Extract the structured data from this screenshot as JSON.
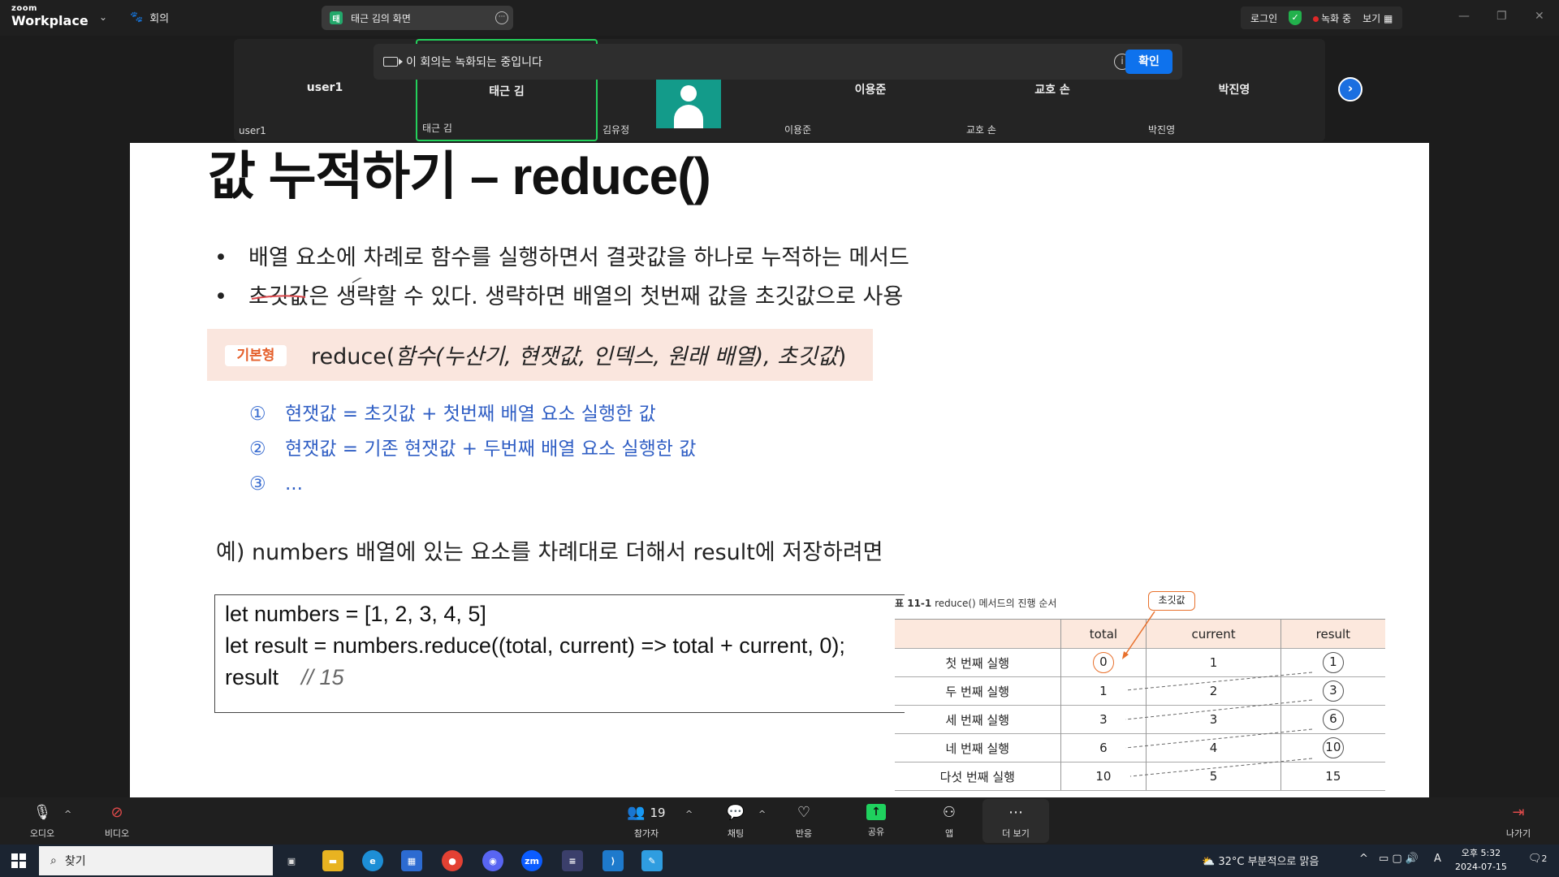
{
  "app": {
    "logo_small": "zoom",
    "logo_big": "Workplace"
  },
  "topbar": {
    "meeting_label": "회의",
    "share_tab_label": "태근 김의 화면",
    "share_tab_icon": "green-badge",
    "login": "로그인",
    "recording": "녹화 중",
    "view": "보기"
  },
  "recording_banner": {
    "text": "이 회의는 녹화되는 중입니다",
    "ok": "확인"
  },
  "participants": [
    {
      "center": "user1",
      "corner": "user1"
    },
    {
      "center": "태근 김",
      "corner": "태근 김"
    },
    {
      "center": "",
      "corner": "김유정"
    },
    {
      "center": "이용준",
      "corner": "이용준"
    },
    {
      "center": "교호 손",
      "corner": "교호 손"
    },
    {
      "center": "박진영",
      "corner": "박진영"
    }
  ],
  "slide": {
    "title": "값 누적하기 – reduce()",
    "bullets": [
      "배열 요소에 차례로 함수를 실행하면서 결괏값을 하나로 누적하는 메서드",
      "초깃값은 생략할 수 있다. 생략하면 배열의 첫번째 값을 초깃값으로 사용"
    ],
    "syntax_tag": "기본형",
    "syntax_fn": "reduce(",
    "syntax_args": "함수(누산기, 현잿값, 인덱스, 원래 배열), 초깃값",
    "syntax_close": ")",
    "steps": [
      {
        "num": "①",
        "text": "현잿값 = 초깃값 + 첫번째 배열 요소 실행한 값"
      },
      {
        "num": "②",
        "text": "현잿값 = 기존 현잿값 + 두번째 배열 요소 실행한 값"
      },
      {
        "num": "③",
        "text": "..."
      }
    ],
    "example": "예) numbers 배열에 있는 요소를 차례대로 더해서 result에 저장하려면",
    "code": [
      "let numbers = [1, 2, 3, 4, 5]",
      "let result = numbers.reduce((total, current) => total + current, 0);",
      "result"
    ],
    "code_comment": "// 15",
    "table_caption_bold": "표 11-1",
    "table_caption": "reduce() 메서드의 진행 순서",
    "callout": "초깃값",
    "table_headers": [
      "",
      "total",
      "current",
      "result"
    ],
    "table_rows": [
      [
        "첫 번째 실행",
        "0",
        "1",
        "1"
      ],
      [
        "두 번째 실행",
        "1",
        "2",
        "3"
      ],
      [
        "세 번째 실행",
        "3",
        "3",
        "6"
      ],
      [
        "네 번째 실행",
        "6",
        "4",
        "10"
      ],
      [
        "다섯 번째 실행",
        "10",
        "5",
        "15"
      ]
    ]
  },
  "toolbar": {
    "audio": "오디오",
    "video": "비디오",
    "participants": "참가자",
    "participants_count": "19",
    "chat": "채팅",
    "reactions": "반응",
    "share": "공유",
    "apps": "앱",
    "more": "더 보기",
    "leave": "나가기"
  },
  "taskbar": {
    "search": "찾기",
    "weather": "32°C  부분적으로 맑음",
    "ime": "A",
    "time": "오후 5:32",
    "date": "2024-07-15",
    "notif_count": "2"
  },
  "colors": {
    "accent_blue": "#0e72ed",
    "active_green": "#23d05b",
    "step_blue": "#2f5ec4",
    "syntax_bg": "#fae6de",
    "orange": "#e8712d"
  }
}
